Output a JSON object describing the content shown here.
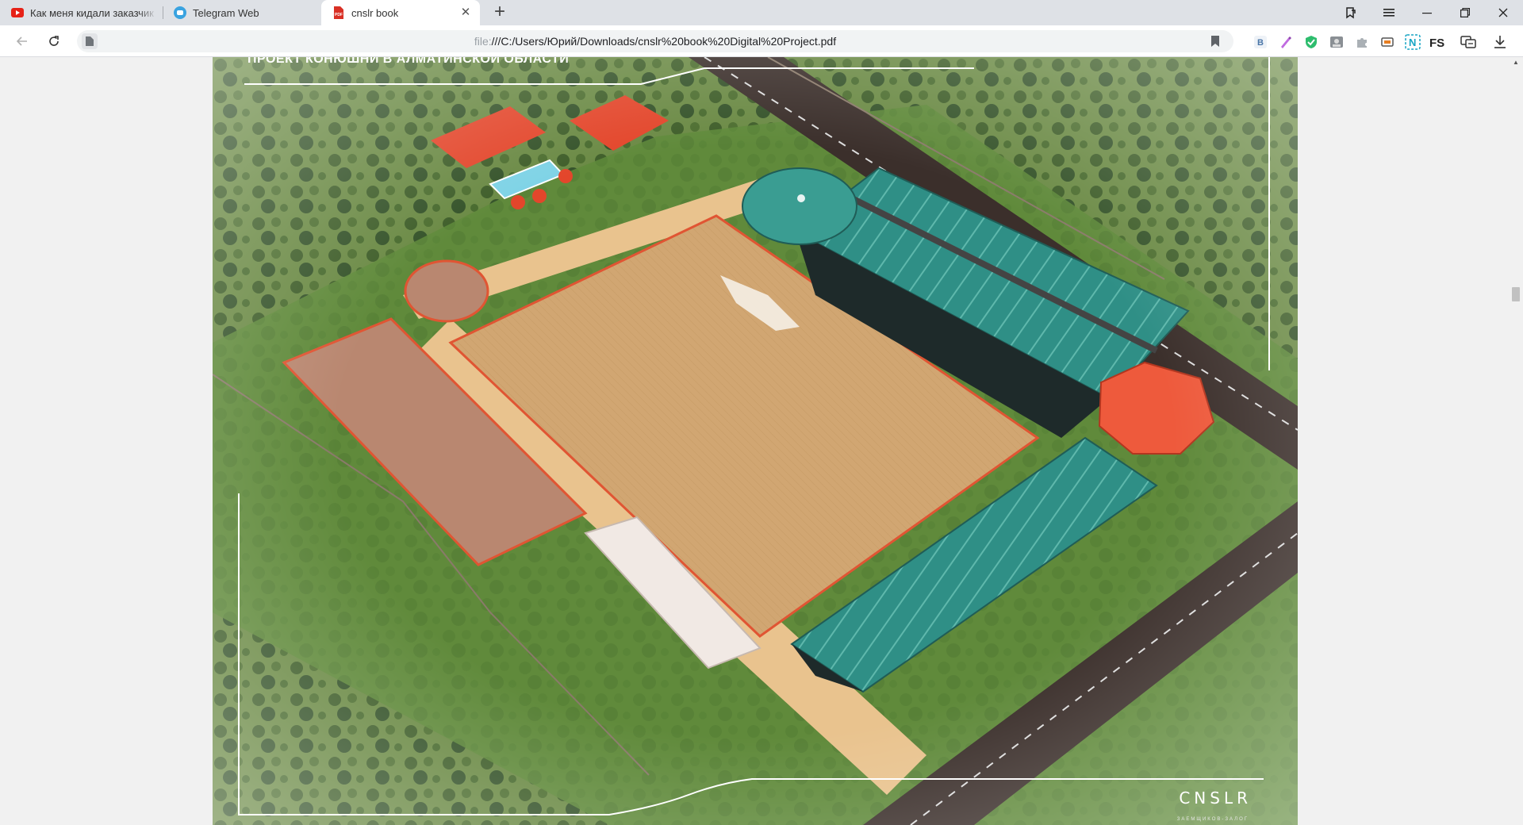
{
  "tabs": [
    {
      "title": "Как меня кидали заказчик",
      "icon": "youtube-icon"
    },
    {
      "title": "Telegram Web",
      "icon": "telegram-icon"
    },
    {
      "title": "cnslr book",
      "icon": "pdf-icon",
      "active": true
    }
  ],
  "window_controls": {
    "tabs_menu": "tabs-menu-icon",
    "menu": "hamburger-icon",
    "minimize": "minimize-icon",
    "restore": "restore-icon",
    "close": "close-icon"
  },
  "address_bar": {
    "scheme": "file:",
    "path": "///C:/Users/Юрий/Downloads/cnslr%20book%20Digital%20Project.pdf"
  },
  "extensions": [
    {
      "name": "vk-extension-icon",
      "label": "B",
      "color": "#4a76a8"
    },
    {
      "name": "pen-extension-icon",
      "label": "",
      "color": "#8e44ad"
    },
    {
      "name": "shield-extension-icon",
      "label": "",
      "color": "#2ecc71"
    },
    {
      "name": "image-extension-icon",
      "label": "",
      "color": "#7f8c8d"
    },
    {
      "name": "puzzle-extension-icon",
      "label": "",
      "color": "#95a5a6"
    },
    {
      "name": "screenshot-extension-icon",
      "label": "",
      "color": "#e67e22"
    },
    {
      "name": "n-extension-icon",
      "label": "N",
      "color": "#16a4c4"
    },
    {
      "name": "fs-extension-icon",
      "label": "FS",
      "color": "#222222"
    },
    {
      "name": "translate-extension-icon",
      "label": "",
      "color": "#333333"
    },
    {
      "name": "download-icon",
      "label": "",
      "color": "#333333"
    }
  ],
  "document": {
    "heading": "ПРОЕКТ КОНЮШНИ В АЛМАТИНСКОЙ ОБЛАСТИ",
    "brand": "CNSLR",
    "brand_subtitle": "ЗАЕМЩИКОВ-ЗАЛОГ"
  },
  "colors": {
    "tab_bar": "#dee1e6",
    "active_tab": "#ffffff",
    "roof_teal": "#2f8f86",
    "roof_red": "#e5452c",
    "arena_sand": "#d4a86a"
  }
}
